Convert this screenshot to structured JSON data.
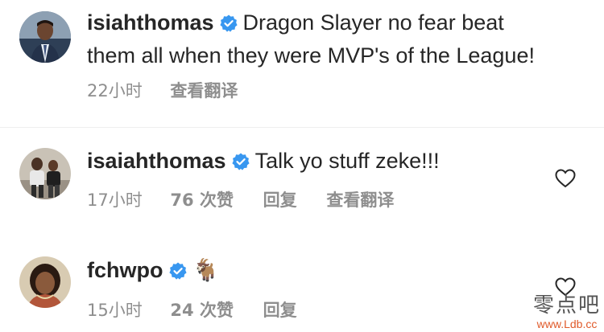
{
  "comments": [
    {
      "username": "isiahthomas",
      "verified": true,
      "text_line1": "Dragon Slayer no fear beat",
      "text_line2": "them all when they were MVP's of the League!",
      "time": "22小时",
      "likes": "",
      "reply": "",
      "translate": "查看翻译",
      "avatar_icon": "man-in-suit-avatar"
    },
    {
      "username": "isaiahthomas",
      "verified": true,
      "text_line1": "Talk yo stuff zeke!!!",
      "text_line2": "",
      "time": "17小时",
      "likes": "76 次赞",
      "reply": "回复",
      "translate": "查看翻译",
      "avatar_icon": "two-men-avatar"
    },
    {
      "username": "fchwpo",
      "verified": true,
      "text_line1": "🐐",
      "text_line2": "",
      "time": "15小时",
      "likes": "24 次赞",
      "reply": "回复",
      "translate": "",
      "avatar_icon": "woman-portrait-avatar"
    }
  ],
  "watermark": {
    "cn": "零点吧",
    "url": "www.Ldb.cc"
  },
  "colors": {
    "text": "#262626",
    "meta": "#8e8e8e",
    "verified_badge": "#3897f0",
    "watermark_url": "#e05a2a"
  }
}
